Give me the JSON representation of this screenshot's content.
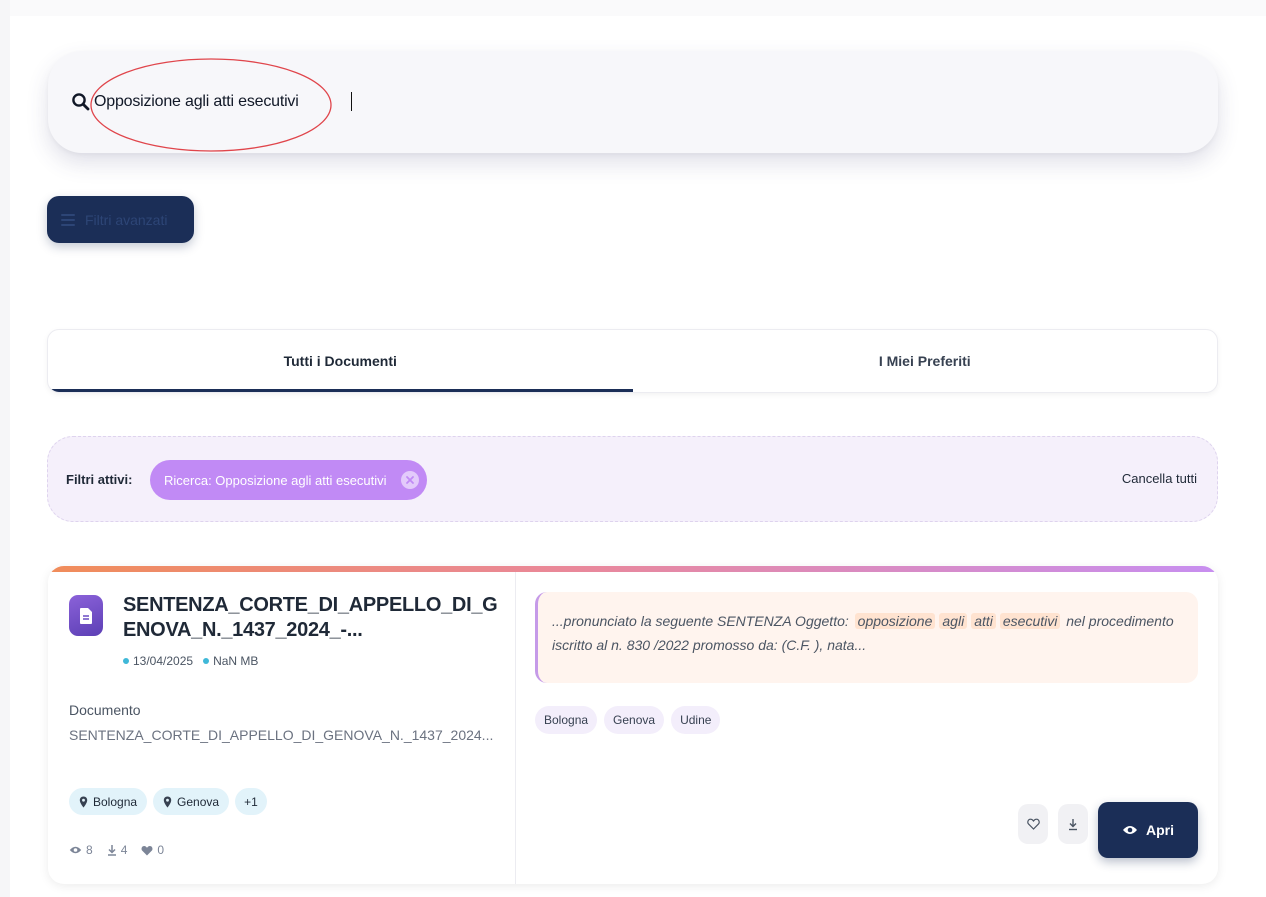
{
  "search": {
    "value": "Opposizione agli atti esecutivi"
  },
  "advanced_filters": {
    "label": "Filtri avanzati"
  },
  "tabs": [
    {
      "label": "Tutti i Documenti",
      "active": true
    },
    {
      "label": "I Miei Preferiti",
      "active": false
    }
  ],
  "active_filters": {
    "label": "Filtri attivi:",
    "chips": [
      {
        "label": "Ricerca: Opposizione agli atti esecutivi"
      }
    ],
    "clear_all_label": "Cancella tutti"
  },
  "document": {
    "title": "SENTENZA_CORTE_DI_APPELLO_DI_GENOVA_N._1437_2024_-...",
    "date": "13/04/2025",
    "size": "NaN MB",
    "type_label": "Documento",
    "filename": "SENTENZA_CORTE_DI_APPELLO_DI_GENOVA_N._1437_2024...",
    "locations": [
      "Bologna",
      "Genova"
    ],
    "more_locations": "+1",
    "stats": {
      "views": "8",
      "downloads": "4",
      "likes": "0"
    },
    "snippet": {
      "prefix": "...pronunciato la seguente SENTENZA Oggetto:",
      "highlights": [
        "opposizione",
        "agli",
        "atti",
        "esecutivi"
      ],
      "suffix": "nel procedimento iscritto al n. 830 /2022 promosso da: (C.F. ), nata..."
    },
    "tags": [
      "Bologna",
      "Genova",
      "Udine"
    ],
    "open_label": "Apri"
  },
  "colors": {
    "primary": "#1b2e57",
    "chip": "#c18af5",
    "annotation": "#e0454b"
  }
}
